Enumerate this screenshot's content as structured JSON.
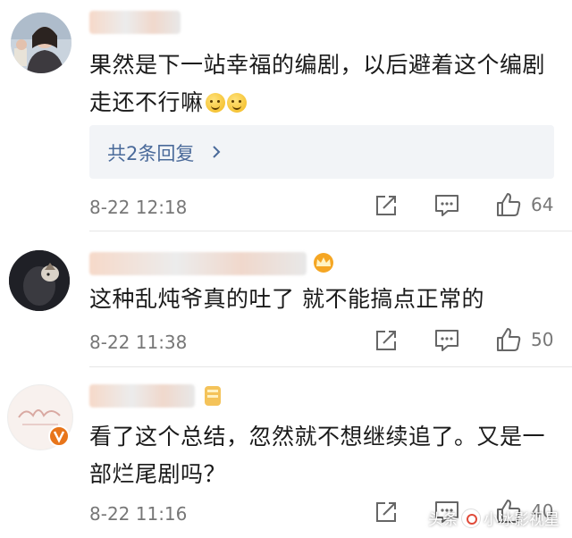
{
  "comments": [
    {
      "text": "果然是下一站幸福的编剧，以后避着这个编剧走还不行嘛",
      "replies_label": "共2条回复",
      "time": "8-22 12:18",
      "likes": "64"
    },
    {
      "text": "这种乱炖爷真的吐了 就不能搞点正常的",
      "time": "8-22 11:38",
      "likes": "50"
    },
    {
      "text": "看了这个总结，忽然就不想继续追了。又是一部烂尾剧吗？",
      "time": "8-22 11:16",
      "likes": "40"
    }
  ],
  "icons": {
    "share": "share-icon",
    "comment": "comment-icon",
    "like": "thumbs-up-icon",
    "reply_chevron": "chevron-right-icon"
  },
  "watermark": {
    "source": "头条",
    "account": "小冰影视星"
  },
  "colors": {
    "reply_link": "#4a6a9a",
    "meta_text": "#777777",
    "reply_box_bg": "#f2f4f7",
    "verified_badge": "#e8751a"
  }
}
